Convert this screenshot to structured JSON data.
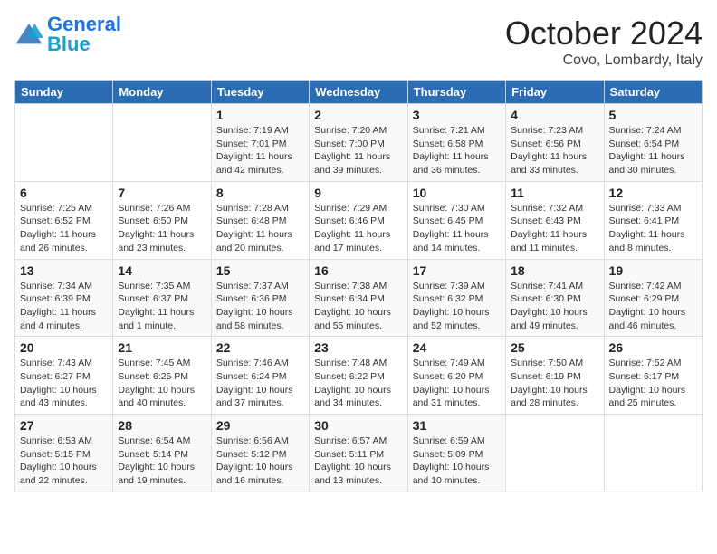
{
  "header": {
    "logo_general": "General",
    "logo_blue": "Blue",
    "month_title": "October 2024",
    "location": "Covo, Lombardy, Italy"
  },
  "days_of_week": [
    "Sunday",
    "Monday",
    "Tuesday",
    "Wednesday",
    "Thursday",
    "Friday",
    "Saturday"
  ],
  "weeks": [
    [
      {
        "day": "",
        "detail": ""
      },
      {
        "day": "",
        "detail": ""
      },
      {
        "day": "1",
        "detail": "Sunrise: 7:19 AM\nSunset: 7:01 PM\nDaylight: 11 hours and 42 minutes."
      },
      {
        "day": "2",
        "detail": "Sunrise: 7:20 AM\nSunset: 7:00 PM\nDaylight: 11 hours and 39 minutes."
      },
      {
        "day": "3",
        "detail": "Sunrise: 7:21 AM\nSunset: 6:58 PM\nDaylight: 11 hours and 36 minutes."
      },
      {
        "day": "4",
        "detail": "Sunrise: 7:23 AM\nSunset: 6:56 PM\nDaylight: 11 hours and 33 minutes."
      },
      {
        "day": "5",
        "detail": "Sunrise: 7:24 AM\nSunset: 6:54 PM\nDaylight: 11 hours and 30 minutes."
      }
    ],
    [
      {
        "day": "6",
        "detail": "Sunrise: 7:25 AM\nSunset: 6:52 PM\nDaylight: 11 hours and 26 minutes."
      },
      {
        "day": "7",
        "detail": "Sunrise: 7:26 AM\nSunset: 6:50 PM\nDaylight: 11 hours and 23 minutes."
      },
      {
        "day": "8",
        "detail": "Sunrise: 7:28 AM\nSunset: 6:48 PM\nDaylight: 11 hours and 20 minutes."
      },
      {
        "day": "9",
        "detail": "Sunrise: 7:29 AM\nSunset: 6:46 PM\nDaylight: 11 hours and 17 minutes."
      },
      {
        "day": "10",
        "detail": "Sunrise: 7:30 AM\nSunset: 6:45 PM\nDaylight: 11 hours and 14 minutes."
      },
      {
        "day": "11",
        "detail": "Sunrise: 7:32 AM\nSunset: 6:43 PM\nDaylight: 11 hours and 11 minutes."
      },
      {
        "day": "12",
        "detail": "Sunrise: 7:33 AM\nSunset: 6:41 PM\nDaylight: 11 hours and 8 minutes."
      }
    ],
    [
      {
        "day": "13",
        "detail": "Sunrise: 7:34 AM\nSunset: 6:39 PM\nDaylight: 11 hours and 4 minutes."
      },
      {
        "day": "14",
        "detail": "Sunrise: 7:35 AM\nSunset: 6:37 PM\nDaylight: 11 hours and 1 minute."
      },
      {
        "day": "15",
        "detail": "Sunrise: 7:37 AM\nSunset: 6:36 PM\nDaylight: 10 hours and 58 minutes."
      },
      {
        "day": "16",
        "detail": "Sunrise: 7:38 AM\nSunset: 6:34 PM\nDaylight: 10 hours and 55 minutes."
      },
      {
        "day": "17",
        "detail": "Sunrise: 7:39 AM\nSunset: 6:32 PM\nDaylight: 10 hours and 52 minutes."
      },
      {
        "day": "18",
        "detail": "Sunrise: 7:41 AM\nSunset: 6:30 PM\nDaylight: 10 hours and 49 minutes."
      },
      {
        "day": "19",
        "detail": "Sunrise: 7:42 AM\nSunset: 6:29 PM\nDaylight: 10 hours and 46 minutes."
      }
    ],
    [
      {
        "day": "20",
        "detail": "Sunrise: 7:43 AM\nSunset: 6:27 PM\nDaylight: 10 hours and 43 minutes."
      },
      {
        "day": "21",
        "detail": "Sunrise: 7:45 AM\nSunset: 6:25 PM\nDaylight: 10 hours and 40 minutes."
      },
      {
        "day": "22",
        "detail": "Sunrise: 7:46 AM\nSunset: 6:24 PM\nDaylight: 10 hours and 37 minutes."
      },
      {
        "day": "23",
        "detail": "Sunrise: 7:48 AM\nSunset: 6:22 PM\nDaylight: 10 hours and 34 minutes."
      },
      {
        "day": "24",
        "detail": "Sunrise: 7:49 AM\nSunset: 6:20 PM\nDaylight: 10 hours and 31 minutes."
      },
      {
        "day": "25",
        "detail": "Sunrise: 7:50 AM\nSunset: 6:19 PM\nDaylight: 10 hours and 28 minutes."
      },
      {
        "day": "26",
        "detail": "Sunrise: 7:52 AM\nSunset: 6:17 PM\nDaylight: 10 hours and 25 minutes."
      }
    ],
    [
      {
        "day": "27",
        "detail": "Sunrise: 6:53 AM\nSunset: 5:15 PM\nDaylight: 10 hours and 22 minutes."
      },
      {
        "day": "28",
        "detail": "Sunrise: 6:54 AM\nSunset: 5:14 PM\nDaylight: 10 hours and 19 minutes."
      },
      {
        "day": "29",
        "detail": "Sunrise: 6:56 AM\nSunset: 5:12 PM\nDaylight: 10 hours and 16 minutes."
      },
      {
        "day": "30",
        "detail": "Sunrise: 6:57 AM\nSunset: 5:11 PM\nDaylight: 10 hours and 13 minutes."
      },
      {
        "day": "31",
        "detail": "Sunrise: 6:59 AM\nSunset: 5:09 PM\nDaylight: 10 hours and 10 minutes."
      },
      {
        "day": "",
        "detail": ""
      },
      {
        "day": "",
        "detail": ""
      }
    ]
  ]
}
